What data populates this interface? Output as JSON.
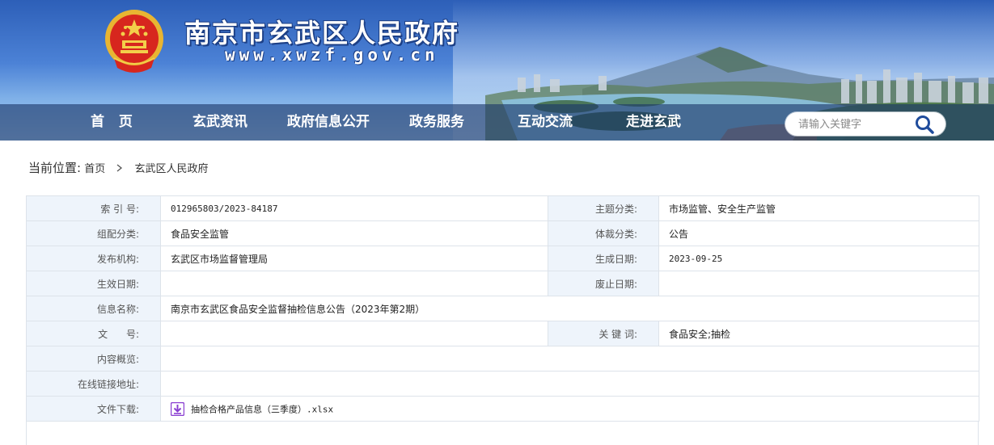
{
  "header": {
    "site_title": "南京市玄武区人民政府",
    "site_url": "www.xwzf.gov.cn"
  },
  "nav": {
    "items": [
      {
        "label": "首  页"
      },
      {
        "label": "玄武资讯"
      },
      {
        "label": "政府信息公开"
      },
      {
        "label": "政务服务"
      },
      {
        "label": "互动交流"
      },
      {
        "label": "走进玄武"
      }
    ],
    "search_placeholder": "请输入关键字"
  },
  "breadcrumb": {
    "label": "当前位置:",
    "items": [
      "首页",
      "玄武区人民政府"
    ],
    "separator": ">"
  },
  "info": {
    "index_no_label": "索 引 号:",
    "index_no": "012965803/2023-84187",
    "topic_label": "主题分类:",
    "topic": "市场监管、安全生产监管",
    "category_label": "组配分类:",
    "category": "食品安全监管",
    "genre_label": "体裁分类:",
    "genre": "公告",
    "publisher_label": "发布机构:",
    "publisher": "玄武区市场监督管理局",
    "created_label": "生成日期:",
    "created": "2023-09-25",
    "effective_label": "生效日期:",
    "effective": "",
    "abolish_label": "废止日期:",
    "abolish": "",
    "name_label": "信息名称:",
    "name": "南京市玄武区食品安全监督抽检信息公告（2023年第2期）",
    "doc_no_label": "文      号:",
    "doc_no": "",
    "keywords_label": "关 键 词:",
    "keywords": "食品安全;抽检",
    "summary_label": "内容概览:",
    "summary": "",
    "online_link_label": "在线链接地址:",
    "online_link": "",
    "download_label": "文件下载:",
    "download_file": "抽检合格产品信息（三季度）.xlsx"
  },
  "colors": {
    "nav_bg": "#1c3769",
    "label_bg": "#eef4fb",
    "border": "#dde3ea",
    "download_icon": "#8a3fd1"
  }
}
